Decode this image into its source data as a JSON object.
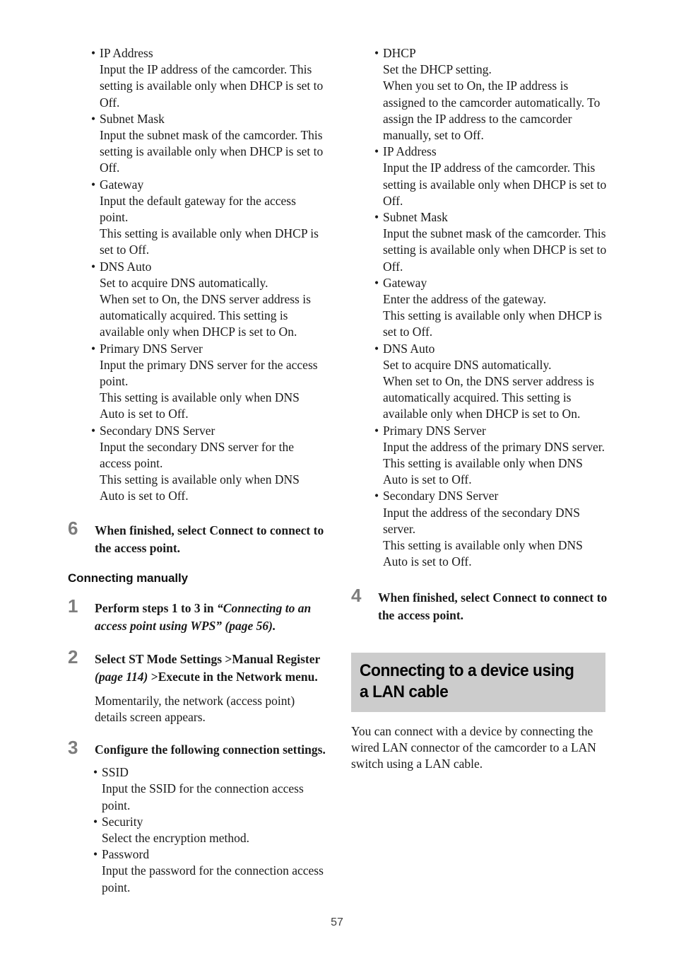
{
  "page": {
    "number": "57",
    "banner_bg": "#cccccc",
    "step_number_color": "#7d7d7d"
  },
  "left_column": {
    "settings_list": [
      {
        "term": "IP Address",
        "desc": "Input the IP address of the camcorder. This setting is available only when DHCP is set to Off."
      },
      {
        "term": "Subnet Mask",
        "desc": "Input the subnet mask of the camcorder. This setting is available only when DHCP is set to Off."
      },
      {
        "term": "Gateway",
        "desc": "Input the default gateway for the access point.\nThis setting is available only when DHCP is set to Off."
      },
      {
        "term": "DNS Auto",
        "desc": "Set to acquire DNS automatically.\nWhen set to On, the DNS server address is automatically acquired. This setting is available only when DHCP is set to On."
      },
      {
        "term": "Primary DNS Server",
        "desc": "Input the primary DNS server for the access point.\nThis setting is available only when DNS Auto is set to Off."
      },
      {
        "term": "Secondary DNS Server",
        "desc": "Input the secondary DNS server for the access point.\nThis setting is available only when DNS Auto is set to Off."
      }
    ],
    "step6": {
      "num": "6",
      "title": "When finished, select Connect to connect to the access point."
    },
    "subhead": "Connecting manually",
    "step1": {
      "num": "1",
      "title_part1": "Perform steps 1 to 3 in ",
      "title_italic": "“Connecting to an access point using WPS” (page 56)."
    },
    "step2": {
      "num": "2",
      "title_part1": "Select ST Mode Settings >Manual Register ",
      "title_italic": "(page 114)",
      "title_part2": " >Execute in the Network menu.",
      "body": "Momentarily, the network (access point) details screen appears."
    },
    "step3": {
      "num": "3",
      "title": "Configure the following connection settings.",
      "settings_list": [
        {
          "term": "SSID",
          "desc": "Input the SSID for the connection access point."
        },
        {
          "term": "Security",
          "desc": "Select the encryption method."
        },
        {
          "term": "Password",
          "desc": "Input the password for the connection access point."
        }
      ]
    }
  },
  "right_column": {
    "settings_list": [
      {
        "term": "DHCP",
        "desc": "Set the DHCP setting.\nWhen you set to On, the IP address is assigned to the camcorder automatically. To assign the IP address to the camcorder manually, set to Off."
      },
      {
        "term": "IP Address",
        "desc": "Input the IP address of the camcorder. This setting is available only when DHCP is set to Off."
      },
      {
        "term": "Subnet Mask",
        "desc": "Input the subnet mask of the camcorder. This setting is available only when DHCP is set to Off."
      },
      {
        "term": "Gateway",
        "desc": "Enter the address of the gateway.\nThis setting is available only when DHCP is set to Off."
      },
      {
        "term": "DNS Auto",
        "desc": "Set to acquire DNS automatically.\nWhen set to On, the DNS server address is automatically acquired. This setting is available only when DHCP is set to On."
      },
      {
        "term": "Primary DNS Server",
        "desc": "Input the address of the primary DNS server.\nThis setting is available only when DNS Auto is set to Off."
      },
      {
        "term": "Secondary DNS Server",
        "desc": "Input the address of the secondary DNS server.\nThis setting is available only when DNS Auto is set to Off."
      }
    ],
    "step4": {
      "num": "4",
      "title": "When finished, select Connect to connect to the access point."
    },
    "section": {
      "heading": "Connecting to a device using a LAN cable",
      "body": "You can connect with a device by connecting the wired LAN connector of the camcorder to a LAN switch using a LAN cable."
    }
  },
  "bullet_glyph": "•"
}
